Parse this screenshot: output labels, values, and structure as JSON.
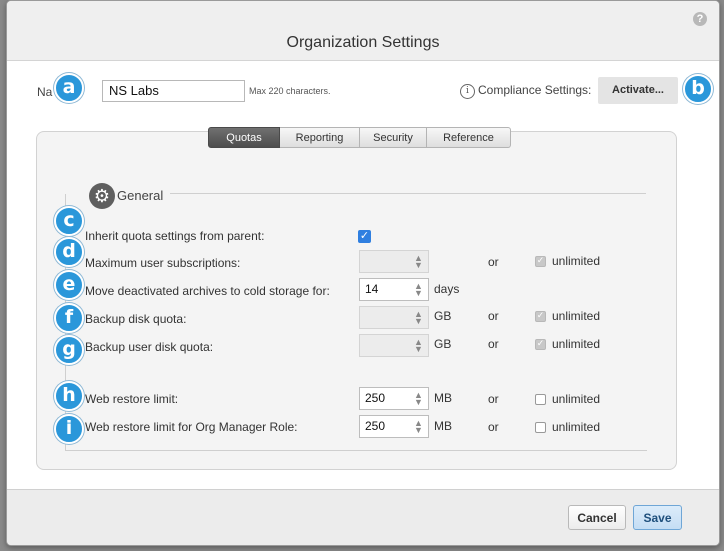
{
  "dialog": {
    "title": "Organization Settings",
    "help_icon": "?"
  },
  "name": {
    "label": "Na",
    "value": "NS Labs",
    "hint": "Max 220 characters."
  },
  "compliance": {
    "label": "Compliance Settings:",
    "button": "Activate...",
    "info_icon": "i"
  },
  "tabs": [
    {
      "label": "Quotas",
      "active": true
    },
    {
      "label": "Reporting",
      "active": false
    },
    {
      "label": "Security",
      "active": false
    },
    {
      "label": "Reference",
      "active": false
    }
  ],
  "section": {
    "title": "General",
    "icon": "gear-icon"
  },
  "markers": [
    "a",
    "b",
    "c",
    "d",
    "e",
    "f",
    "g",
    "h",
    "i"
  ],
  "rows": {
    "inherit": {
      "label": "Inherit quota settings from parent:",
      "checked": true
    },
    "max_subs": {
      "label": "Maximum user subscriptions:",
      "value": "",
      "or": "or",
      "unlimited": "unlimited",
      "unlimited_checked": true
    },
    "cold_storage": {
      "label": "Move deactivated archives to cold storage for:",
      "value": "14",
      "unit": "days"
    },
    "backup_quota": {
      "label": "Backup disk quota:",
      "value": "",
      "unit": "GB",
      "or": "or",
      "unlimited": "unlimited",
      "unlimited_checked": true
    },
    "backup_user_quota": {
      "label": "Backup user disk quota:",
      "value": "",
      "unit": "GB",
      "or": "or",
      "unlimited": "unlimited",
      "unlimited_checked": true
    },
    "web_restore": {
      "label": "Web restore limit:",
      "value": "250",
      "unit": "MB",
      "or": "or",
      "unlimited": "unlimited",
      "unlimited_checked": false
    },
    "web_restore_org": {
      "label": "Web restore limit for Org Manager Role:",
      "value": "250",
      "unit": "MB",
      "or": "or",
      "unlimited": "unlimited",
      "unlimited_checked": false
    }
  },
  "footer": {
    "cancel": "Cancel",
    "save": "Save"
  },
  "colors": {
    "marker": "#2a97da",
    "active_tab": "#5a5a5a",
    "checkbox_blue": "#2f7fe0"
  }
}
